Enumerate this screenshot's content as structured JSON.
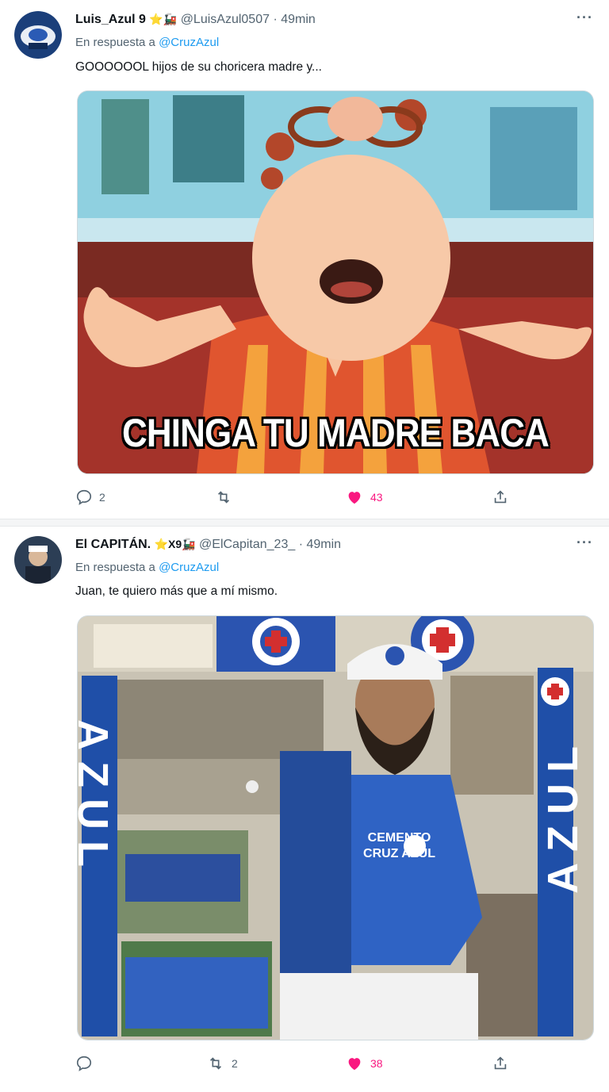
{
  "tweets": [
    {
      "name": "Luis_Azul 9",
      "badges": "⭐🚂",
      "handle": "@LuisAzul0507",
      "time": "· 49min",
      "reply_prefix": "En respuesta a",
      "reply_mention": "@CruzAzul",
      "text": "GOOOOOOL hijos de su choricera madre y...",
      "image_caption": "CHINGA TU MADRE BACA",
      "replies": "2",
      "retweets": "",
      "likes": "43",
      "liked": true
    },
    {
      "name": "El CAPITÁN.",
      "badges": "⭐X9🚂",
      "handle": "@ElCapitan_23_",
      "time": "· 49min",
      "reply_prefix": "En respuesta a",
      "reply_mention": "@CruzAzul",
      "text": "Juan, te quiero más que a mí mismo.",
      "image_texts": {
        "banner_left": "AZUL",
        "banner_right": "AZUL",
        "shirt": "CEMENTO CRUZ AZUL"
      },
      "replies": "",
      "retweets": "2",
      "likes": "38",
      "liked": true
    }
  ],
  "colors": {
    "like": "#f91880",
    "mention": "#1d9bf0",
    "muted": "#536471",
    "cruz_azul_blue": "#1f4fa8"
  },
  "icons": [
    "reply-icon",
    "retweet-icon",
    "heart-icon",
    "share-icon",
    "more-icon"
  ]
}
